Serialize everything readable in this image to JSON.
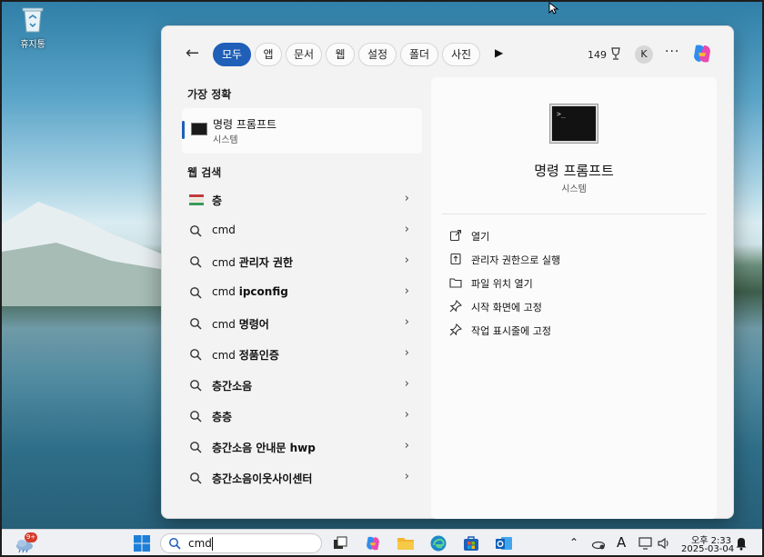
{
  "desktop": {
    "recycle_bin_label": "휴지통"
  },
  "search_panel": {
    "filters": [
      {
        "label": "모두",
        "active": true
      },
      {
        "label": "앱"
      },
      {
        "label": "문서"
      },
      {
        "label": "웹"
      },
      {
        "label": "설정"
      },
      {
        "label": "폴더"
      },
      {
        "label": "사진"
      }
    ],
    "points": "149",
    "avatar_initial": "K",
    "more_label": "···",
    "best_match_heading": "가장 정확",
    "best_match": {
      "name": "명령 프롬프트",
      "type": "시스템"
    },
    "web_search_heading": "웹 검색",
    "web_results": [
      {
        "prefix": "",
        "bold": "층",
        "icon": "image-thumbnail-icon"
      },
      {
        "prefix": "cmd",
        "bold": "",
        "icon": "search-icon"
      },
      {
        "prefix": "cmd ",
        "bold": "관리자 권한",
        "icon": "search-icon"
      },
      {
        "prefix": "cmd ",
        "bold": "ipconfig",
        "icon": "search-icon"
      },
      {
        "prefix": "cmd ",
        "bold": "명령어",
        "icon": "search-icon"
      },
      {
        "prefix": "cmd ",
        "bold": "정품인증",
        "icon": "search-icon"
      },
      {
        "prefix": "",
        "bold": "층간소음",
        "icon": "search-icon"
      },
      {
        "prefix": "",
        "bold": "층층",
        "icon": "search-icon"
      },
      {
        "prefix": "",
        "bold": "층간소음 안내문 hwp",
        "icon": "search-icon"
      },
      {
        "prefix": "",
        "bold": "층간소음이웃사이센터",
        "icon": "search-icon"
      }
    ],
    "detail": {
      "icon_text": ">_",
      "title": "명령 프롬프트",
      "subtitle": "시스템",
      "actions": [
        {
          "label": "열기",
          "icon": "open-external-icon"
        },
        {
          "label": "관리자 권한으로 실행",
          "icon": "admin-shield-icon"
        },
        {
          "label": "파일 위치 열기",
          "icon": "folder-icon"
        },
        {
          "label": "시작 화면에 고정",
          "icon": "pin-icon"
        },
        {
          "label": "작업 표시줄에 고정",
          "icon": "pin-icon"
        }
      ]
    }
  },
  "taskbar": {
    "weather_badge": "9+",
    "search_text": "cmd",
    "tray": {
      "ime": "A",
      "time": "오후 2:33",
      "date": "2025-03-04"
    }
  },
  "colors": {
    "accent": "#1f5fb8",
    "panel_bg": "#f3f3f3",
    "detail_bg": "#fbfbfb",
    "taskbar_bg": "#eef0f3"
  }
}
